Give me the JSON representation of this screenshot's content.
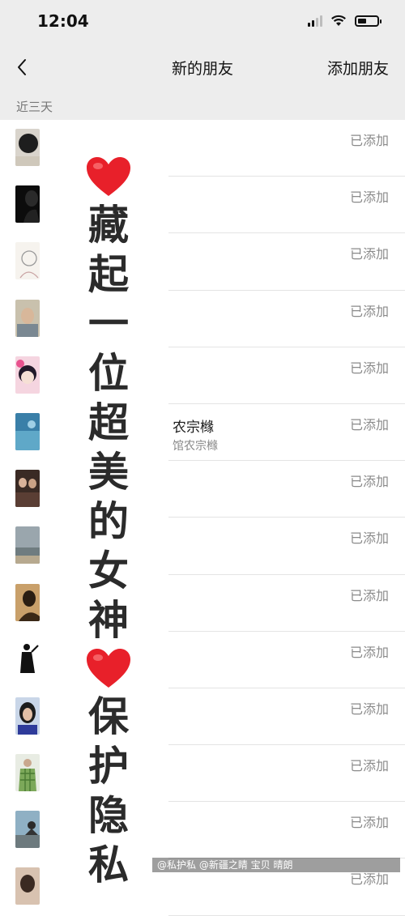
{
  "status_bar": {
    "time": "12:04",
    "battery_level": 0.45
  },
  "nav": {
    "title": "新的朋友",
    "action_label": "添加朋友"
  },
  "section": {
    "label": "近三天"
  },
  "rows": [
    {
      "name": "",
      "sub": "",
      "status": "已添加",
      "avatar": "dark-cat"
    },
    {
      "name": "",
      "sub": "",
      "status": "已添加",
      "avatar": "silhouette"
    },
    {
      "name": "",
      "sub": "",
      "status": "已添加",
      "avatar": "sketch"
    },
    {
      "name": "",
      "sub": "",
      "status": "已添加",
      "avatar": "selfie"
    },
    {
      "name": "",
      "sub": "",
      "status": "已添加",
      "avatar": "cartoon-girl"
    },
    {
      "name": "农宗橼",
      "sub": "馆农宗橼",
      "status": "已添加",
      "avatar": "blue-water"
    },
    {
      "name": "",
      "sub": "",
      "status": "已添加",
      "avatar": "couple"
    },
    {
      "name": "",
      "sub": "",
      "status": "已添加",
      "avatar": "seascape"
    },
    {
      "name": "",
      "sub": "",
      "status": "已添加",
      "avatar": "warm-silhouette"
    },
    {
      "name": "",
      "sub": "",
      "status": "已添加",
      "avatar": "dancer"
    },
    {
      "name": "",
      "sub": "",
      "status": "已添加",
      "avatar": "woman-portrait"
    },
    {
      "name": "",
      "sub": "",
      "status": "已添加",
      "avatar": "green-plaid"
    },
    {
      "name": "",
      "sub": "",
      "status": "已添加",
      "avatar": "rider"
    },
    {
      "name": "",
      "sub": "",
      "status": "已添加",
      "avatar": "partial"
    }
  ],
  "overlay": {
    "lines": [
      "藏",
      "起",
      "一",
      "位",
      "超",
      "美",
      "的",
      "女",
      "神"
    ],
    "lines2": [
      "保",
      "护",
      "隐",
      "私"
    ],
    "heart_color": "#e8202a"
  },
  "watermark": "@私护私 @新疆之睛 宝贝 晴朗"
}
